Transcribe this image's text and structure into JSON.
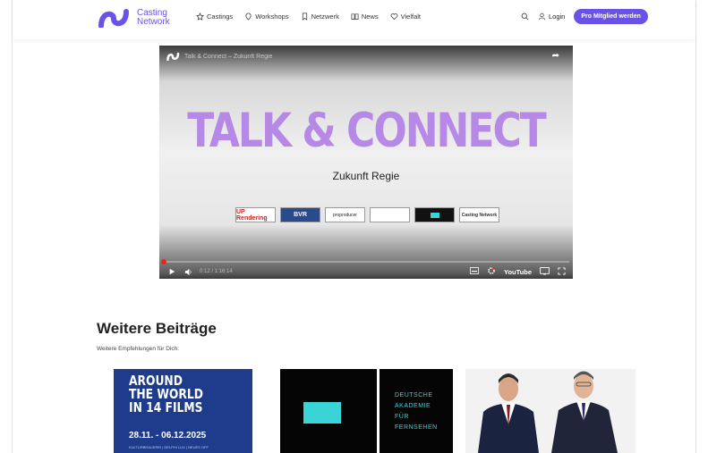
{
  "header": {
    "logo_line1": "Casting",
    "logo_line2": "Network",
    "nav": [
      {
        "label": "Castings",
        "icon": "star-icon"
      },
      {
        "label": "Workshops",
        "icon": "location-pin-icon"
      },
      {
        "label": "Netzwerk",
        "icon": "bookmark-icon"
      },
      {
        "label": "News",
        "icon": "book-icon"
      },
      {
        "label": "Vielfalt",
        "icon": "heart-badge-icon"
      }
    ],
    "search_icon": "search-icon",
    "login_label": "Login",
    "cta_label": "Pro Mitglied werden",
    "accent_color": "#6b52e6"
  },
  "video": {
    "title": "Talk & Connect – Zukunft Regie",
    "headline": "TALK & CONNECT",
    "subtitle": "Zukunft Regie",
    "partner_logos": [
      "UP Rendering",
      "BVR",
      "proproducer",
      "",
      "",
      "Casting Network"
    ],
    "time": "0:12 / 1:16:14",
    "youtube_label": "YouTube",
    "progress": 0.003
  },
  "section": {
    "title": "Weitere Beiträge",
    "subtitle": "Weitere Empfehlungen für Dich:"
  },
  "thumbnails": [
    {
      "lines": [
        "AROUND",
        "THE WORLD",
        "IN 14 FILMS"
      ],
      "date": "28.11. - 06.12.2025",
      "small": "KULTURBRAUEREI | DELPHI LUX | NEUES OFF"
    },
    {
      "lines": [
        "DEUTSCHE",
        "AKADEMIE",
        "FÜR",
        "FERNSEHEN"
      ]
    },
    {
      "alt": "two men in suits"
    }
  ]
}
